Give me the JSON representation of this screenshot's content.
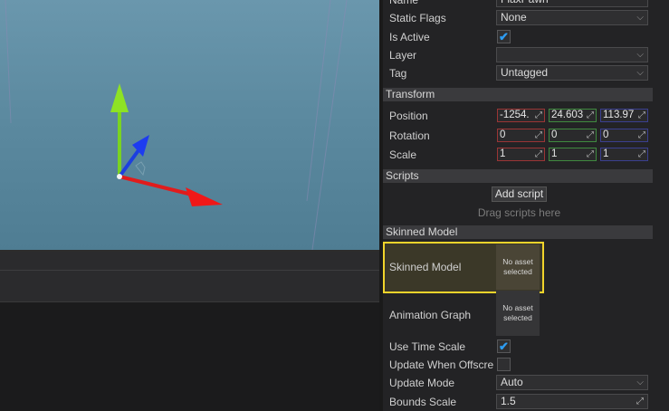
{
  "properties": {
    "name": {
      "label": "Name",
      "value": "FlaxPawn"
    },
    "static_flags": {
      "label": "Static Flags",
      "value": "None"
    },
    "is_active": {
      "label": "Is Active",
      "checked": true
    },
    "layer": {
      "label": "Layer",
      "value": ""
    },
    "tag": {
      "label": "Tag",
      "value": "Untagged"
    },
    "transform": {
      "header": "Transform",
      "position": {
        "label": "Position",
        "x": "-1254.",
        "y": "24.603",
        "z": "113.97"
      },
      "rotation": {
        "label": "Rotation",
        "x": "0",
        "y": "0",
        "z": "0"
      },
      "scale": {
        "label": "Scale",
        "x": "1",
        "y": "1",
        "z": "1"
      }
    },
    "scripts": {
      "header": "Scripts",
      "add_button": "Add script",
      "drop_hint": "Drag scripts here"
    },
    "skinned_model": {
      "header": "Skinned Model",
      "model": {
        "label": "Skinned Model",
        "asset": "No asset selected"
      },
      "animation_graph": {
        "label": "Animation Graph",
        "asset": "No asset selected"
      },
      "use_time_scale": {
        "label": "Use Time Scale",
        "checked": true
      },
      "update_when_offscreen": {
        "label": "Update When Offscre",
        "checked": false
      },
      "update_mode": {
        "label": "Update Mode",
        "value": "Auto"
      },
      "bounds_scale": {
        "label": "Bounds Scale",
        "value": "1.5"
      }
    }
  },
  "icons": {
    "checkmark": "✔",
    "chevron": "⌵",
    "drag": "⤢"
  },
  "colors": {
    "highlight": "#f1d42b",
    "axis_x": "#e02020",
    "axis_y": "#7ad321",
    "axis_z": "#1c3fe0",
    "checkbox_tick": "#2d9cf2"
  }
}
